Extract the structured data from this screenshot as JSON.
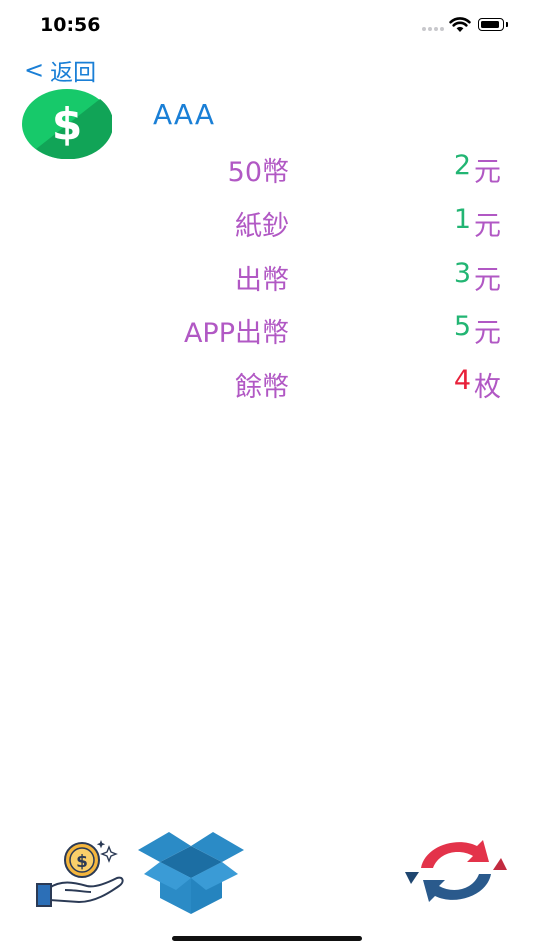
{
  "status": {
    "time": "10:56"
  },
  "nav": {
    "back_label": "返回",
    "back_chevron": "<"
  },
  "header": {
    "title": "AAA"
  },
  "rows": [
    {
      "label": "50幣",
      "value": "2",
      "unit": "元",
      "value_color": "#22b573"
    },
    {
      "label": "紙鈔",
      "value": "1",
      "unit": "元",
      "value_color": "#22b573"
    },
    {
      "label": "出幣",
      "value": "3",
      "unit": "元",
      "value_color": "#22b573"
    },
    {
      "label": "APP出幣",
      "value": "5",
      "unit": "元",
      "value_color": "#22b573"
    },
    {
      "label": "餘幣",
      "value": "4",
      "unit": "枚",
      "value_color": "#e8213a"
    }
  ],
  "icons": {
    "logo": "dollar-circle-icon",
    "pay": "hand-coin-icon",
    "box": "open-box-icon",
    "refresh": "refresh-arrows-icon"
  },
  "colors": {
    "accent": "#1a7fd6",
    "label": "#b158c4",
    "positive": "#22b573",
    "warning": "#e8213a"
  }
}
